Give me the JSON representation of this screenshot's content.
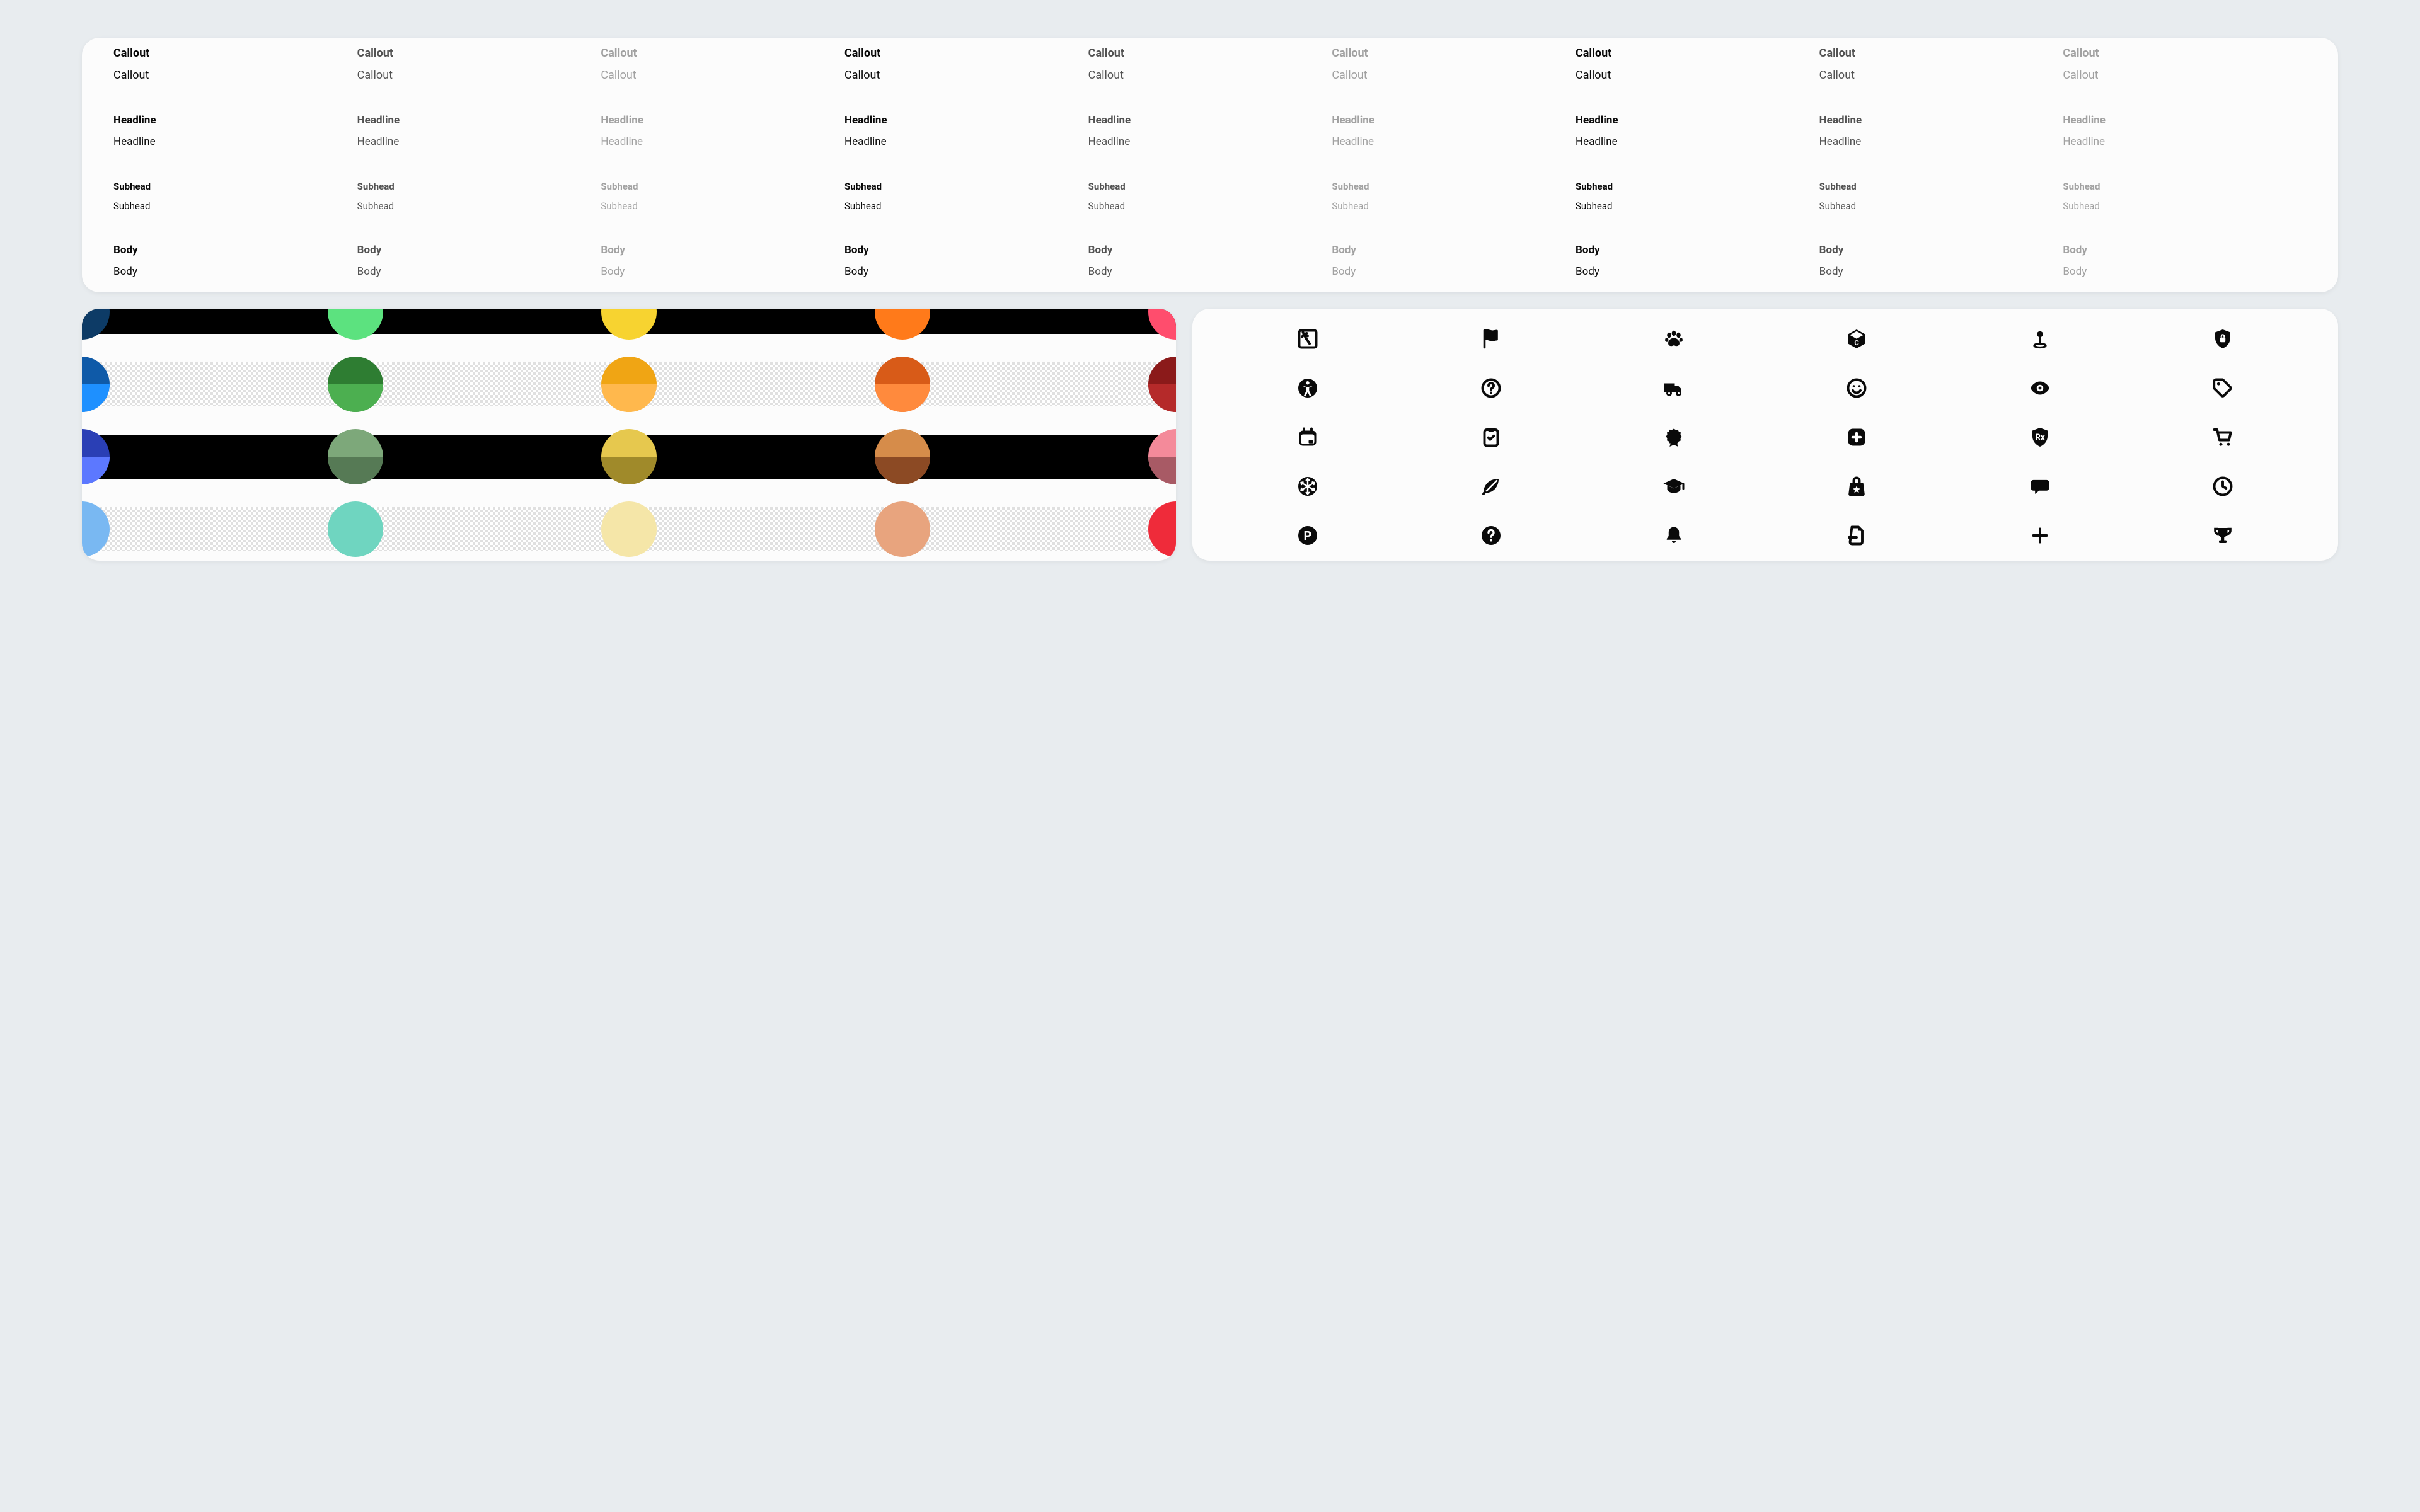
{
  "typography": {
    "styles": [
      {
        "label": "Callout",
        "size": "sz-callout"
      },
      {
        "label": "Headline",
        "size": "sz-headline"
      },
      {
        "label": "Subhead",
        "size": "sz-subhead"
      },
      {
        "label": "Body",
        "size": "sz-body"
      }
    ],
    "tones": [
      "dark",
      "mid",
      "light"
    ],
    "triplets": 3,
    "weights": [
      "bold",
      "reg"
    ]
  },
  "palette": {
    "rows": [
      {
        "bg": "black",
        "split": false,
        "colors": [
          {
            "top": "#0d3b66"
          },
          {
            "top": "#5ce27f"
          },
          {
            "top": "#f7d330"
          },
          {
            "top": "#ff7a1a"
          },
          {
            "top": "#ff4d6d"
          }
        ]
      },
      {
        "bg": "check",
        "split": true,
        "colors": [
          {
            "top": "#0f5aa8",
            "bottom": "#1e90ff"
          },
          {
            "top": "#2e7d32",
            "bottom": "#4caf50"
          },
          {
            "top": "#f0a514",
            "bottom": "#ffb84d"
          },
          {
            "top": "#d85b18",
            "bottom": "#ff8a3d"
          },
          {
            "top": "#8b1a1a",
            "bottom": "#b52a2a"
          }
        ]
      },
      {
        "bg": "black",
        "split": true,
        "colors": [
          {
            "top": "#2a3fb5",
            "bottom": "#5c78ff"
          },
          {
            "top": "#7da87a",
            "bottom": "#567a55"
          },
          {
            "top": "#e6c84e",
            "bottom": "#a08a2a"
          },
          {
            "top": "#d68c4a",
            "bottom": "#8c4a24"
          },
          {
            "top": "#f48a9a",
            "bottom": "#a85a65"
          }
        ]
      },
      {
        "bg": "check",
        "split": false,
        "colors": [
          {
            "top": "#79b8f2"
          },
          {
            "top": "#6fd5c0"
          },
          {
            "top": "#f5e6a8"
          },
          {
            "top": "#e8a47e"
          },
          {
            "top": "#ef2b3a"
          }
        ]
      }
    ]
  },
  "icons": [
    [
      {
        "name": "palm-photo-icon"
      },
      {
        "name": "flag-icon"
      },
      {
        "name": "paw-icon"
      },
      {
        "name": "package-box-icon"
      },
      {
        "name": "map-pin-point-icon"
      },
      {
        "name": "shield-lock-icon"
      }
    ],
    [
      {
        "name": "accessibility-icon"
      },
      {
        "name": "question-circle-icon"
      },
      {
        "name": "truck-delivery-icon"
      },
      {
        "name": "smile-face-icon"
      },
      {
        "name": "eye-icon"
      },
      {
        "name": "tag-price-icon"
      }
    ],
    [
      {
        "name": "calendar-icon"
      },
      {
        "name": "clipboard-check-icon"
      },
      {
        "name": "award-ribbon-icon"
      },
      {
        "name": "plus-square-icon"
      },
      {
        "name": "shield-rx-icon"
      },
      {
        "name": "cart-icon"
      }
    ],
    [
      {
        "name": "snowflake-circle-icon"
      },
      {
        "name": "leaf-icon"
      },
      {
        "name": "graduation-cap-icon"
      },
      {
        "name": "shopping-bag-star-icon"
      },
      {
        "name": "chat-bubble-icon"
      },
      {
        "name": "clock-icon"
      }
    ],
    [
      {
        "name": "parking-circle-icon"
      },
      {
        "name": "question-filled-circle-icon"
      },
      {
        "name": "bell-icon"
      },
      {
        "name": "file-minus-icon"
      },
      {
        "name": "plus-icon"
      },
      {
        "name": "trophy-icon"
      }
    ]
  ]
}
